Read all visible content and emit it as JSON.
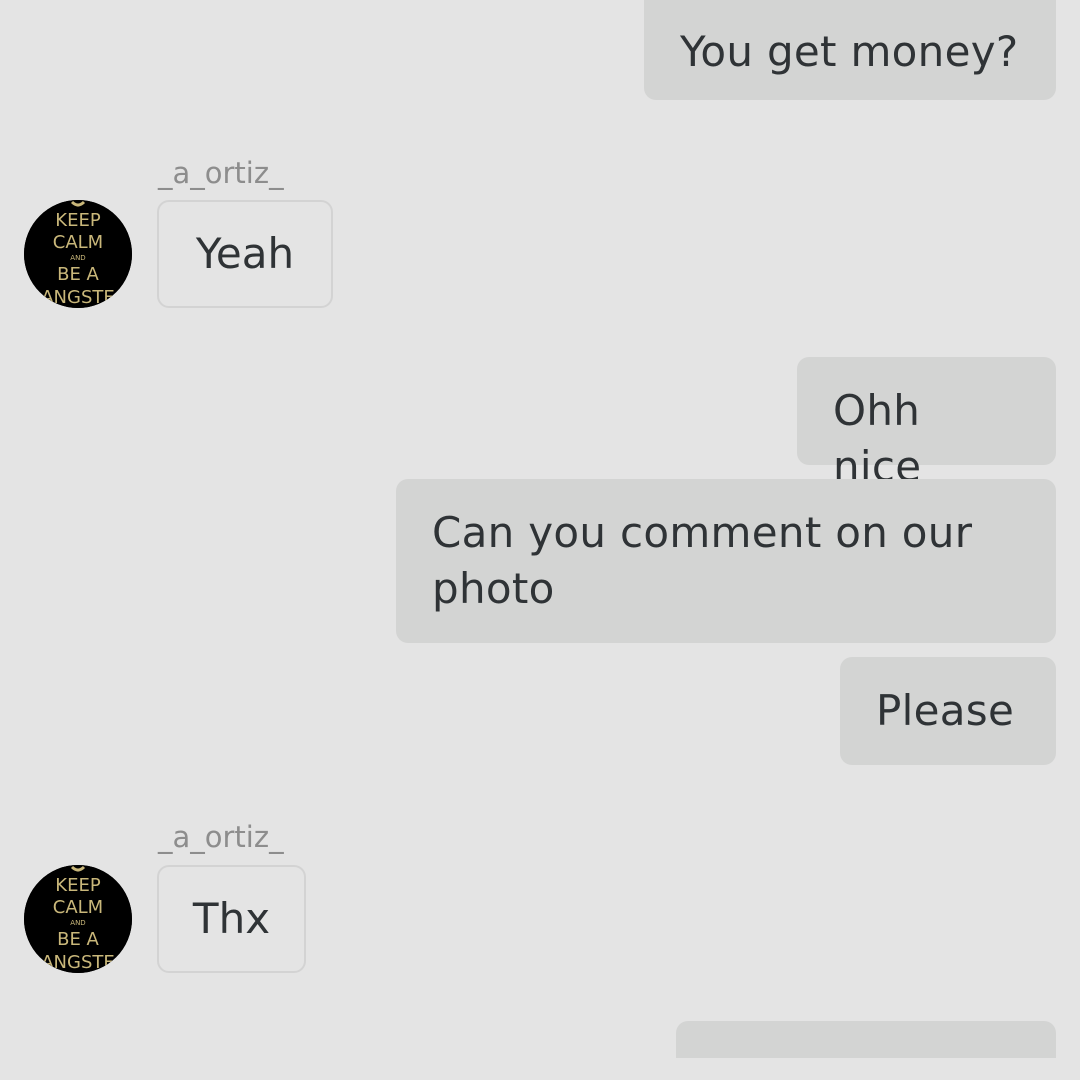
{
  "messages": [
    {
      "side": "out",
      "text": "You get money?"
    },
    {
      "side": "in",
      "username": "_a_ortiz_",
      "text": "Yeah"
    },
    {
      "side": "out",
      "text": "Ohh nice"
    },
    {
      "side": "out",
      "text": "Can you comment on our photo"
    },
    {
      "side": "out",
      "text": "Please"
    },
    {
      "side": "in",
      "username": "_a_ortiz_",
      "text": "Thx"
    },
    {
      "side": "out",
      "text": ""
    }
  ],
  "avatar": {
    "icon": "keep-calm-poster",
    "lines": [
      "KEEP",
      "CALM",
      "AND",
      "BE A",
      "ANGSTE"
    ],
    "text_color": "#c9b77a",
    "background": "#000000"
  },
  "colors": {
    "background": "#e4e4e4",
    "outgoing_bubble": "#d3d4d3",
    "incoming_border": "#d3d3d3",
    "text": "#2f3336",
    "username": "#8d8d8d"
  }
}
